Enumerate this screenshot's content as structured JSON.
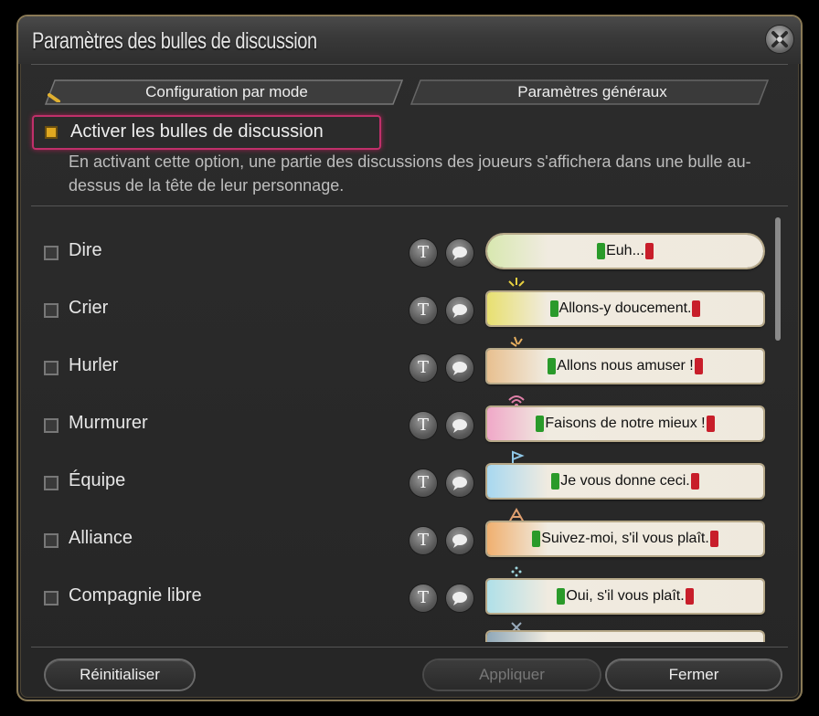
{
  "window": {
    "title": "Paramètres des bulles de discussion"
  },
  "tabs": [
    {
      "label": "Configuration par mode",
      "active": true
    },
    {
      "label": "Paramètres généraux",
      "active": false
    }
  ],
  "master": {
    "label": "Activer les bulles de discussion",
    "checked": true,
    "description": "En activant cette option, une partie des discussions des joueurs s'affichera dans une bulle au-dessus de la tête de leur personnage."
  },
  "channels": [
    {
      "label": "Dire",
      "checked": false,
      "preview": "Euh...",
      "accent": "#d8e8b0",
      "style": "round"
    },
    {
      "label": "Crier",
      "checked": false,
      "preview": "Allons-y doucement.",
      "accent": "#e8e070",
      "style": "flat"
    },
    {
      "label": "Hurler",
      "checked": false,
      "preview": "Allons nous amuser !",
      "accent": "#e8c090",
      "style": "shout"
    },
    {
      "label": "Murmurer",
      "checked": false,
      "preview": "Faisons de notre mieux !",
      "accent": "#f0a8c8",
      "style": "flat"
    },
    {
      "label": "Équipe",
      "checked": false,
      "preview": "Je vous donne ceci.",
      "accent": "#a8d8f0",
      "style": "flat"
    },
    {
      "label": "Alliance",
      "checked": false,
      "preview": "Suivez-moi, s'il vous plaît.",
      "accent": "#f0b070",
      "style": "flat"
    },
    {
      "label": "Compagnie libre",
      "checked": false,
      "preview": "Oui, s'il vous plaît.",
      "accent": "#b0e0e8",
      "style": "flat"
    }
  ],
  "buttons": {
    "reset": "Réinitialiser",
    "apply": "Appliquer",
    "close": "Fermer"
  },
  "colors": {
    "master_highlight": "#c0306a",
    "checkbox_on": "#e0a820",
    "quote_open": "#2a9a2a",
    "quote_close": "#c81e2a"
  }
}
